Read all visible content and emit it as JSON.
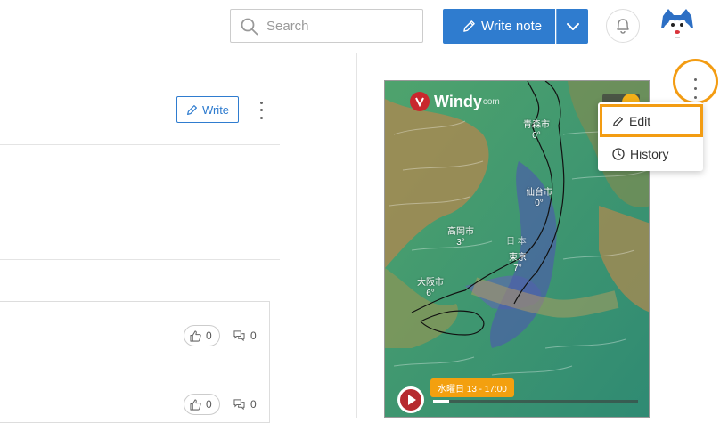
{
  "header": {
    "search_placeholder": "Search",
    "write_note_label": "Write note",
    "icons": [
      "search-icon",
      "pencil-icon",
      "chevron-down-icon",
      "bell-icon",
      "avatar"
    ]
  },
  "left_panel": {
    "write_label": "Write",
    "cards": [
      {
        "likes": "0",
        "comments": "0"
      },
      {
        "likes": "0",
        "comments": "0"
      }
    ]
  },
  "map": {
    "brand": "Windy",
    "brand_suffix": "com",
    "cities": [
      {
        "name": "青森市",
        "temp": "0°"
      },
      {
        "name": "仙台市",
        "temp": "0°"
      },
      {
        "name": "高岡市",
        "temp": "3°"
      },
      {
        "name": "東京",
        "temp": "7°"
      },
      {
        "name": "大阪市",
        "temp": "6°"
      }
    ],
    "country_label": "日 本",
    "timestamp": "水曜日 13 - 17:00",
    "progress_fraction": 0.08
  },
  "context_menu": {
    "items": [
      {
        "label": "Edit",
        "icon": "pencil-icon"
      },
      {
        "label": "History",
        "icon": "clock-icon"
      }
    ]
  },
  "colors": {
    "primary": "#2f7ccf",
    "highlight": "#f39c12",
    "windy_red": "#c9282d",
    "timeline_orange": "#f3a00f"
  }
}
